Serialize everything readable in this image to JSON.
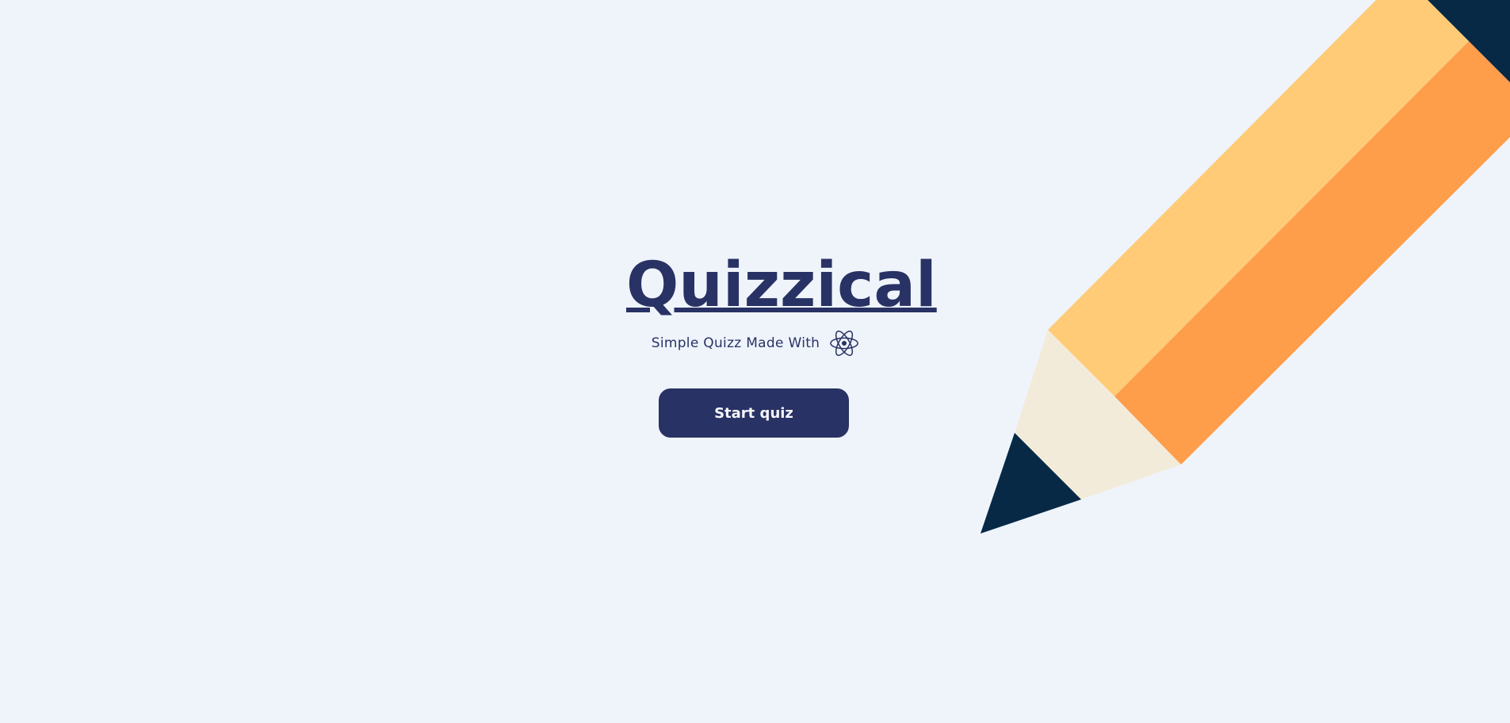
{
  "app": {
    "title": "Quizzical",
    "subtitle": "Simple Quizz Made With",
    "tech_icon": "react-icon"
  },
  "actions": {
    "start_label": "Start quiz"
  },
  "colors": {
    "background": "#EFF4FB",
    "primary": "#293264",
    "button_text": "#F5F7FB",
    "pencil_body_light": "#FFCB77",
    "pencil_body_dark": "#FE9D4A",
    "pencil_wood": "#F3EBDA",
    "pencil_tip": "#072946"
  },
  "decorations": {
    "pencil_icon": "pencil-illustration"
  }
}
